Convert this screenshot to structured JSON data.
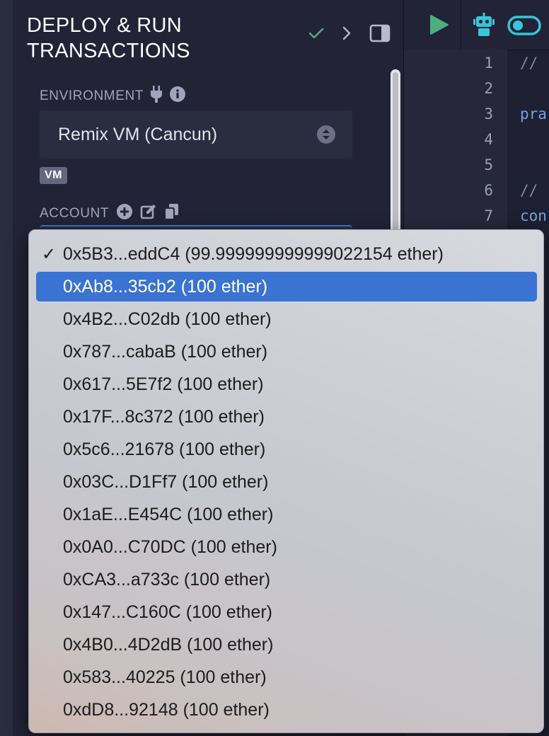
{
  "panel": {
    "title_line1": "DEPLOY & RUN",
    "title_line2": "TRANSACTIONS",
    "environment_label": "ENVIRONMENT",
    "environment_value": "Remix VM (Cancun)",
    "vm_badge": "VM",
    "account_label": "ACCOUNT"
  },
  "colors": {
    "background": "#222336",
    "check_green": "#4caf7d",
    "accent_teal": "#38c6d8",
    "selected_item": "#3a73d2"
  },
  "editor": {
    "line_numbers": [
      "1",
      "2",
      "3",
      "4",
      "5",
      "6",
      "7"
    ],
    "lines": [
      {
        "text": "//",
        "kind": "comment"
      },
      {
        "text": "",
        "kind": "blank"
      },
      {
        "text": "pra",
        "kind": "keyword"
      },
      {
        "text": "",
        "kind": "blank"
      },
      {
        "text": "",
        "kind": "blank"
      },
      {
        "text": "//",
        "kind": "comment"
      },
      {
        "text": "con",
        "kind": "keyword"
      }
    ]
  },
  "account_dropdown": {
    "checked_index": 0,
    "selected_index": 1,
    "options": [
      "0x5B3...eddC4 (99.999999999999022154 ether)",
      "0xAb8...35cb2 (100 ether)",
      "0x4B2...C02db (100 ether)",
      "0x787...cabaB (100 ether)",
      "0x617...5E7f2 (100 ether)",
      "0x17F...8c372 (100 ether)",
      "0x5c6...21678 (100 ether)",
      "0x03C...D1Ff7 (100 ether)",
      "0x1aE...E454C (100 ether)",
      "0x0A0...C70DC (100 ether)",
      "0xCA3...a733c (100 ether)",
      "0x147...C160C (100 ether)",
      "0x4B0...4D2dB (100 ether)",
      "0x583...40225 (100 ether)",
      "0xdD8...92148 (100 ether)"
    ]
  }
}
